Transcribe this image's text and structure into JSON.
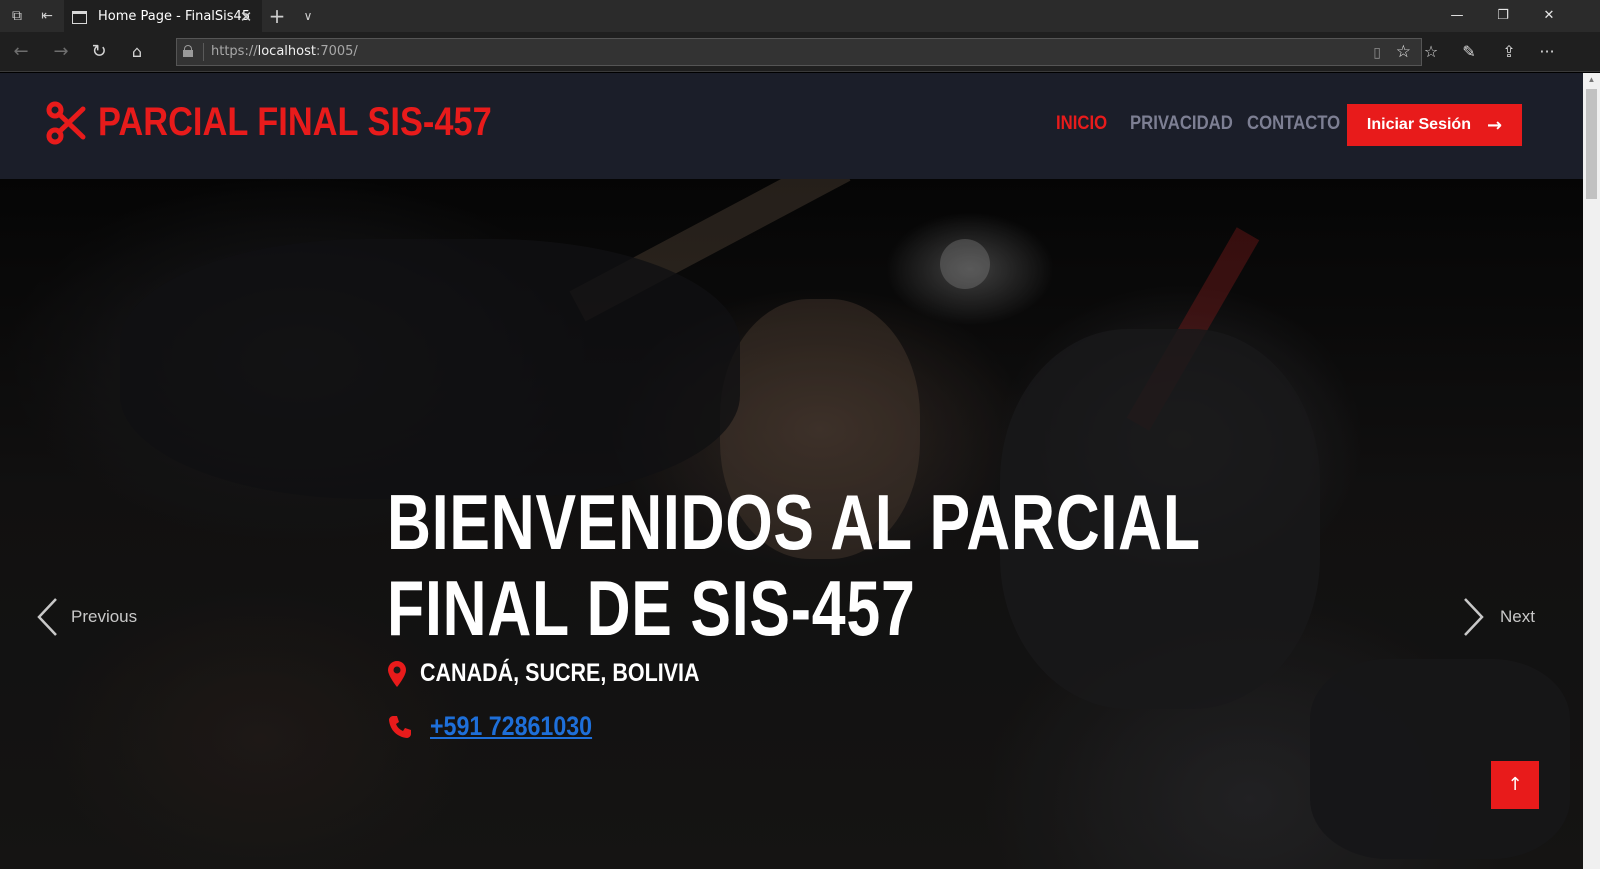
{
  "browser": {
    "tab_title": "Home Page - FinalSis45",
    "url_prefix": "https://",
    "url_host": "localhost",
    "url_suffix": ":7005/"
  },
  "header": {
    "brand": "PARCIAL FINAL SIS-457",
    "brand_icon": "scissors-icon",
    "nav": [
      {
        "label": "INICIO",
        "active": true
      },
      {
        "label": "PRIVACIDAD",
        "active": false
      },
      {
        "label": "CONTACTO",
        "active": false
      }
    ],
    "login_label": "Iniciar Sesión",
    "login_icon": "arrow-right-icon"
  },
  "hero": {
    "title_line1": "BIENVENIDOS AL PARCIAL",
    "title_line2": "FINAL DE SIS-457",
    "location": "CANADÁ, SUCRE, BOLIVIA",
    "location_icon": "map-marker-icon",
    "phone": "+591 72861030",
    "phone_icon": "phone-icon",
    "prev_label": "Previous",
    "next_label": "Next"
  },
  "colors": {
    "accent": "#e81b1b",
    "header_bg": "#1b1e29",
    "nav_inactive": "#7d7f93",
    "link": "#1e6fd9"
  }
}
